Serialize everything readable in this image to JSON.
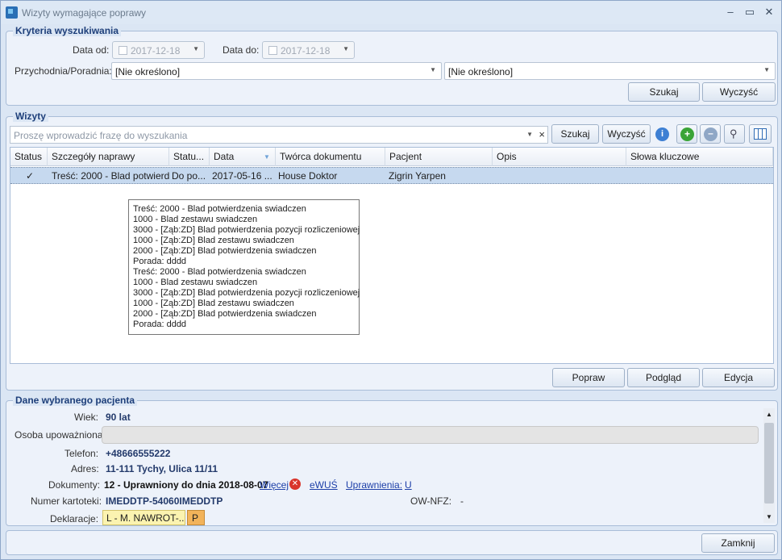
{
  "window": {
    "title": "Wizyty wymagające poprawy"
  },
  "criteria": {
    "legend": "Kryteria wyszukiwania",
    "date_from_label": "Data od:",
    "date_from": "2017-12-18",
    "date_to_label": "Data do:",
    "date_to": "2017-12-18",
    "clinic_label": "Przychodnia/Poradnia:",
    "clinic_value": "[Nie określono]",
    "clinic2_value": "[Nie określono]",
    "search_btn": "Szukaj",
    "clear_btn": "Wyczyść"
  },
  "visits": {
    "legend": "Wizyty",
    "search_placeholder": "Proszę wprowadzić frazę do wyszukania",
    "search_btn": "Szukaj",
    "clear_btn": "Wyczyść",
    "columns": [
      "Status",
      "Szczegóły naprawy",
      "Statu...",
      "Data",
      "Twórca dokumentu",
      "Pacjent",
      "Opis",
      "Słowa kluczowe"
    ],
    "rows": [
      {
        "status": "✓",
        "details": "Treść: 2000 - Blad potwierd...",
        "status2": "Do po...",
        "date": "2017-05-16 ...",
        "author": "House Doktor",
        "patient": "Zigrin Yarpen",
        "desc": "",
        "keywords": ""
      }
    ],
    "tooltip": [
      "Treść: 2000 - Blad potwierdzenia swiadczen",
      "1000 - Blad zestawu swiadczen",
      "3000 - [Ząb:ZD] Blad potwierdzenia pozycji rozliczeniowej",
      "1000 - [Ząb:ZD] Blad zestawu swiadczen",
      "2000 - [Ząb:ZD] Blad potwierdzenia swiadczen",
      "Porada: dddd",
      "Treść: 2000 - Blad potwierdzenia swiadczen",
      "1000 - Blad zestawu swiadczen",
      "3000 - [Ząb:ZD] Blad potwierdzenia pozycji rozliczeniowej",
      "1000 - [Ząb:ZD] Blad zestawu swiadczen",
      "2000 - [Ząb:ZD] Blad potwierdzenia swiadczen",
      "Porada: dddd"
    ],
    "fix_btn": "Popraw",
    "preview_btn": "Podgląd",
    "edit_btn": "Edycja"
  },
  "patient": {
    "legend": "Dane wybranego pacjenta",
    "age_label": "Wiek:",
    "age": "90 lat",
    "proxy_label": "Osoba upoważniona",
    "phone_label": "Telefon:",
    "phone": "+48666555222",
    "address_label": "Adres:",
    "address": "11-111 Tychy, Ulica 11/11",
    "docs_label": "Dokumenty:",
    "docs": "12 - Uprawniony do dnia 2018-08-07",
    "more_link": "Więcej",
    "ewus_link": "eWUŚ",
    "perms_link": "Uprawnienia:",
    "perms_value": "U",
    "card_label": "Numer kartoteki:",
    "card": "IMEDDTP-54060IMEDDTP",
    "ownfz_label": "OW-NFZ:",
    "ownfz": "-",
    "decl_label": "Deklaracje:",
    "decl_value": "L - M. NAWROT-...",
    "decl_p": "P"
  },
  "footer": {
    "close_btn": "Zamknij"
  }
}
